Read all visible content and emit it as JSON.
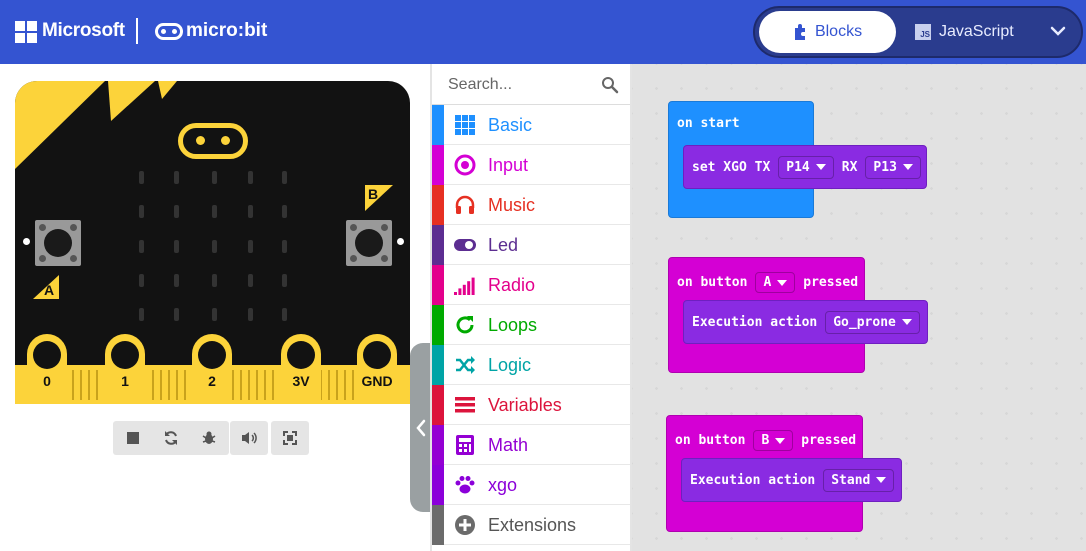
{
  "header": {
    "brand": "Microsoft",
    "product": "micro:bit",
    "tabs": [
      {
        "label": "Blocks",
        "icon": "puzzle-icon",
        "active": true
      },
      {
        "label": "JavaScript",
        "icon": "js-file-icon",
        "badge": "JS",
        "active": false
      }
    ],
    "colors": {
      "bar": "#3454d1",
      "toggle": "#2a3c8e"
    }
  },
  "simulator": {
    "button_labels": [
      "A",
      "B"
    ],
    "pins": [
      "0",
      "1",
      "2",
      "3V",
      "GND"
    ],
    "controls": [
      "stop-icon",
      "restart-icon",
      "debug-icon",
      "sound-icon",
      "fullscreen-icon"
    ]
  },
  "toolbox": {
    "search_placeholder": "Search...",
    "categories": [
      {
        "label": "Basic",
        "color": "#1e90ff",
        "icon": "grid-icon"
      },
      {
        "label": "Input",
        "color": "#d400d4",
        "icon": "target-icon"
      },
      {
        "label": "Music",
        "color": "#e63022",
        "icon": "headphones-icon"
      },
      {
        "label": "Led",
        "color": "#5c2d91",
        "icon": "toggle-icon"
      },
      {
        "label": "Radio",
        "color": "#e3008c",
        "icon": "signal-bars-icon"
      },
      {
        "label": "Loops",
        "color": "#00aa00",
        "icon": "refresh-icon"
      },
      {
        "label": "Logic",
        "color": "#00a4a6",
        "icon": "shuffle-icon"
      },
      {
        "label": "Variables",
        "color": "#dc143c",
        "icon": "lines-icon"
      },
      {
        "label": "Math",
        "color": "#9400d3",
        "icon": "calculator-icon"
      },
      {
        "label": "xgo",
        "color": "#8b00d9",
        "icon": "paw-icon"
      },
      {
        "label": "Extensions",
        "color": "#6b6b6b",
        "icon": "plus-circle-icon"
      }
    ]
  },
  "workspace": {
    "blocks": [
      {
        "hat": "on start",
        "color": "#1e90ff",
        "inner_color": "#8a2be2",
        "inner": {
          "text_a": "set XGO TX",
          "drop_a": "P14",
          "text_b": "RX",
          "drop_b": "P13"
        }
      },
      {
        "hat_a": "on button",
        "hat_drop": "A",
        "hat_b": "pressed",
        "color": "#d400d4",
        "inner_color": "#8a2be2",
        "inner": {
          "text_a": "Execution action",
          "drop_a": "Go_prone"
        }
      },
      {
        "hat_a": "on button",
        "hat_drop": "B",
        "hat_b": "pressed",
        "color": "#d400d4",
        "inner_color": "#8a2be2",
        "inner": {
          "text_a": "Execution action",
          "drop_a": "Stand"
        }
      }
    ]
  }
}
